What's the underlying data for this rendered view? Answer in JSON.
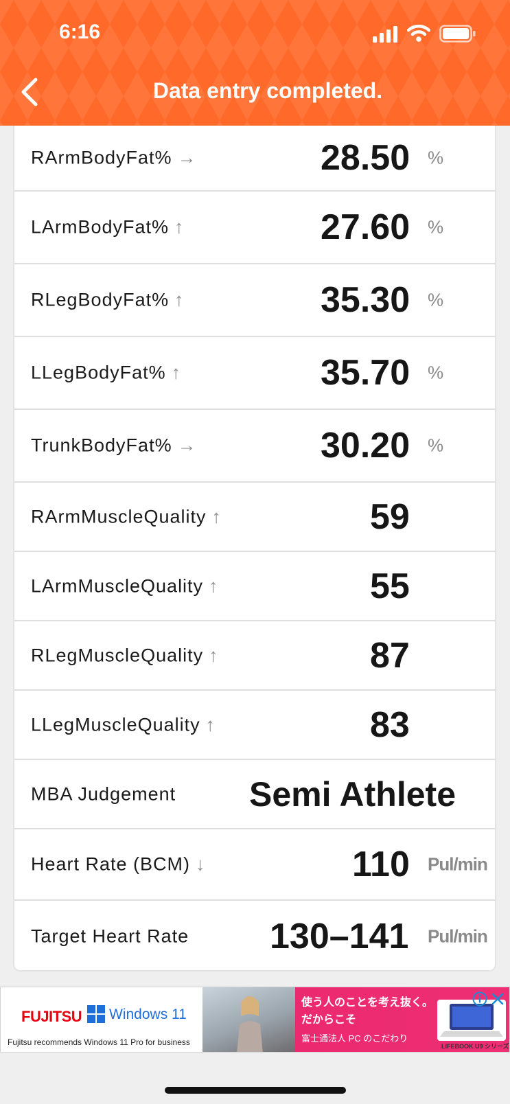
{
  "status_bar": {
    "time": "6:16"
  },
  "header": {
    "title": "Data entry completed.",
    "back_icon": "chevron-left-icon"
  },
  "colors": {
    "accent": "#ff6a2b",
    "text": "#161616",
    "unit": "#8a8a8a"
  },
  "rows": [
    {
      "label": "RArmBodyFat%",
      "arrow": "→",
      "value": "28.50",
      "unit": "%"
    },
    {
      "label": "LArmBodyFat%",
      "arrow": "↑",
      "value": "27.60",
      "unit": "%"
    },
    {
      "label": "RLegBodyFat%",
      "arrow": "↑",
      "value": "35.30",
      "unit": "%"
    },
    {
      "label": "LLegBodyFat%",
      "arrow": "↑",
      "value": "35.70",
      "unit": "%"
    },
    {
      "label": "TrunkBodyFat%",
      "arrow": "→",
      "value": "30.20",
      "unit": "%"
    },
    {
      "label": "RArmMuscleQuality",
      "arrow": "↑",
      "value": "59",
      "unit": ""
    },
    {
      "label": "LArmMuscleQuality",
      "arrow": "↑",
      "value": "55",
      "unit": ""
    },
    {
      "label": "RLegMuscleQuality",
      "arrow": "↑",
      "value": "87",
      "unit": ""
    },
    {
      "label": "LLegMuscleQuality",
      "arrow": "↑",
      "value": "83",
      "unit": ""
    },
    {
      "label": "MBA Judgement",
      "arrow": "",
      "value": "Semi Athlete",
      "unit": ""
    },
    {
      "label": "Heart Rate (BCM)",
      "arrow": "↓",
      "value": "110",
      "unit": "Pul/min"
    },
    {
      "label": "Target Heart Rate",
      "arrow": "",
      "value": "130–141",
      "unit": "Pul/min"
    }
  ],
  "ad": {
    "brand": "FUJITSU",
    "windows": "Windows 11",
    "tagline": "Fujitsu recommends Windows 11 Pro for business",
    "jp_line1": "使う人のことを考え抜く。",
    "jp_line2": "だからこそ",
    "jp_line3": "富士通法人 PC のこだわり",
    "product": "LIFEBOOK U9 シリーズ"
  }
}
